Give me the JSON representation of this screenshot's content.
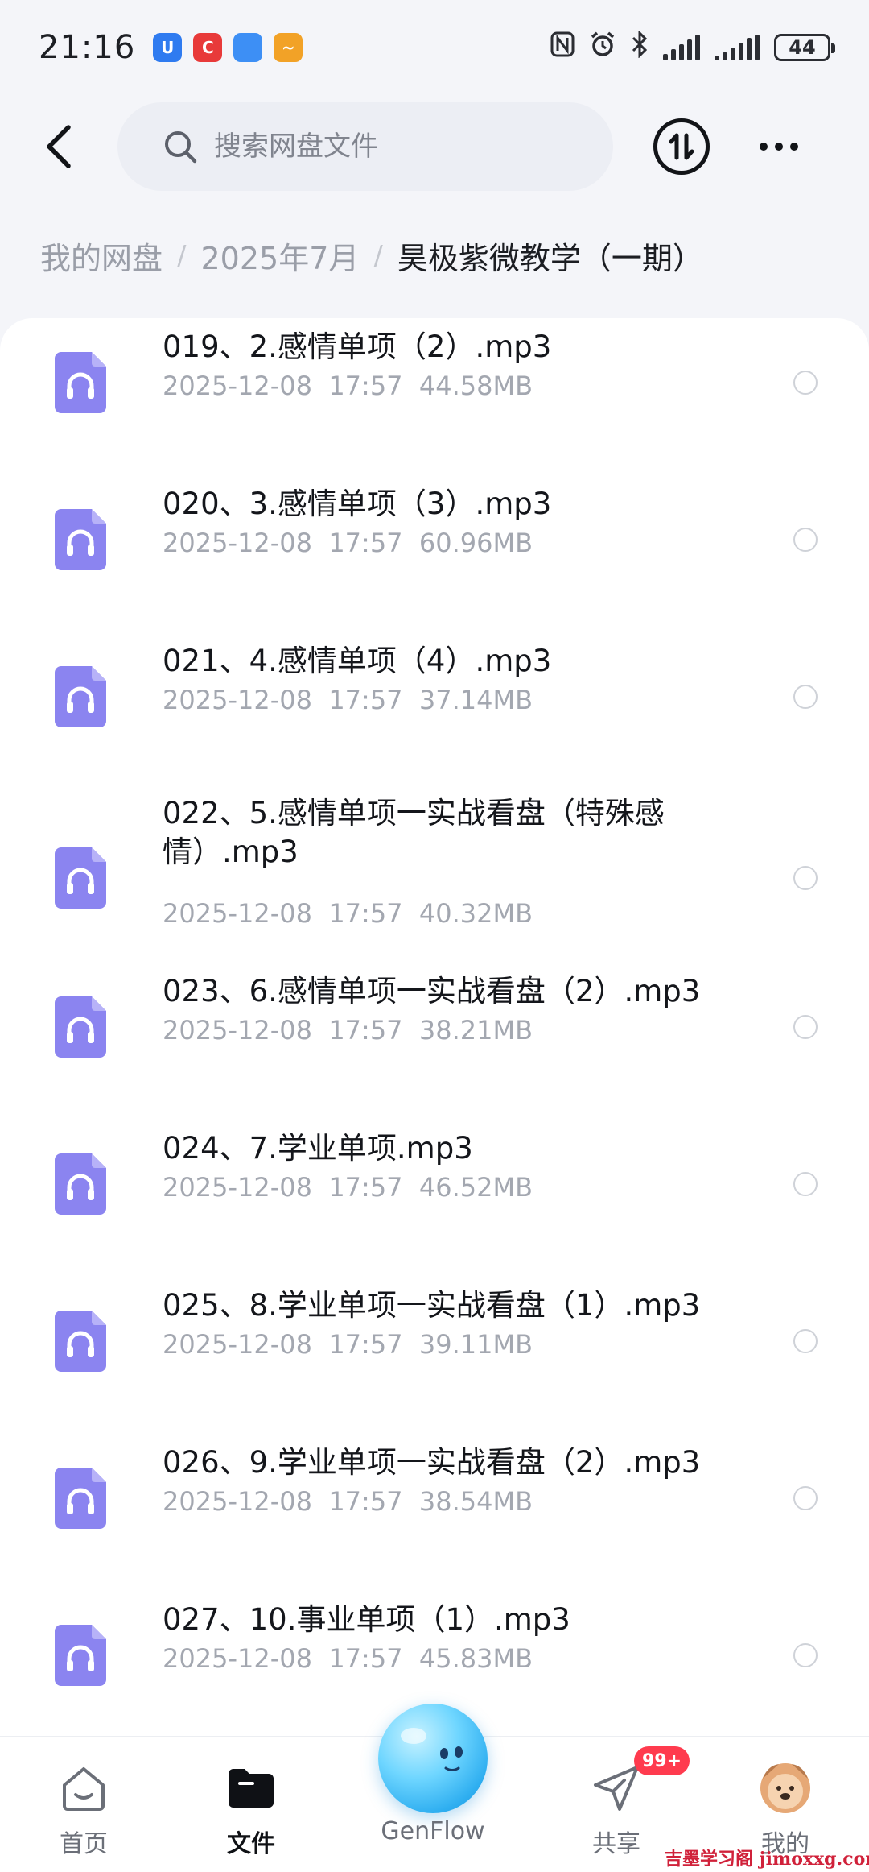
{
  "status_bar": {
    "time": "21:16",
    "battery": "44",
    "apps": [
      {
        "icon": "shield-app-icon",
        "glyph": "U",
        "color": "#2f7bf0"
      },
      {
        "icon": "red-app-icon",
        "glyph": "C",
        "color": "#e83a3a"
      },
      {
        "icon": "blue-orb-app-icon",
        "glyph": "",
        "color": "#3d8ff5"
      },
      {
        "icon": "orange-app-icon",
        "glyph": "~",
        "color": "#f2a227"
      }
    ]
  },
  "header": {
    "search_placeholder": "搜索网盘文件"
  },
  "breadcrumb": [
    "我的网盘",
    "2025年7月",
    "昊极紫微教学（一期）"
  ],
  "files": [
    {
      "name": "019、2.感情单项（2）.mp3",
      "date": "2025-12-08",
      "time": "17:57",
      "size": "44.58MB"
    },
    {
      "name": "020、3.感情单项（3）.mp3",
      "date": "2025-12-08",
      "time": "17:57",
      "size": "60.96MB"
    },
    {
      "name": "021、4.感情单项（4）.mp3",
      "date": "2025-12-08",
      "time": "17:57",
      "size": "37.14MB"
    },
    {
      "name": "022、5.感情单项一实战看盘（特殊感情）.mp3",
      "date": "2025-12-08",
      "time": "17:57",
      "size": "40.32MB"
    },
    {
      "name": "023、6.感情单项一实战看盘（2）.mp3",
      "date": "2025-12-08",
      "time": "17:57",
      "size": "38.21MB"
    },
    {
      "name": "024、7.学业单项.mp3",
      "date": "2025-12-08",
      "time": "17:57",
      "size": "46.52MB"
    },
    {
      "name": "025、8.学业单项一实战看盘（1）.mp3",
      "date": "2025-12-08",
      "time": "17:57",
      "size": "39.11MB"
    },
    {
      "name": "026、9.学业单项一实战看盘（2）.mp3",
      "date": "2025-12-08",
      "time": "17:57",
      "size": "38.54MB"
    },
    {
      "name": "027、10.事业单项（1）.mp3",
      "date": "2025-12-08",
      "time": "17:57",
      "size": "45.83MB"
    }
  ],
  "nav": {
    "home": "首页",
    "files": "文件",
    "genflow": "GenFlow",
    "share": "共享",
    "share_badge": "99+",
    "mine": "我的"
  },
  "accent_color": "#8b84f0",
  "watermark": "吉墨学习阁 jimoxxg.com"
}
